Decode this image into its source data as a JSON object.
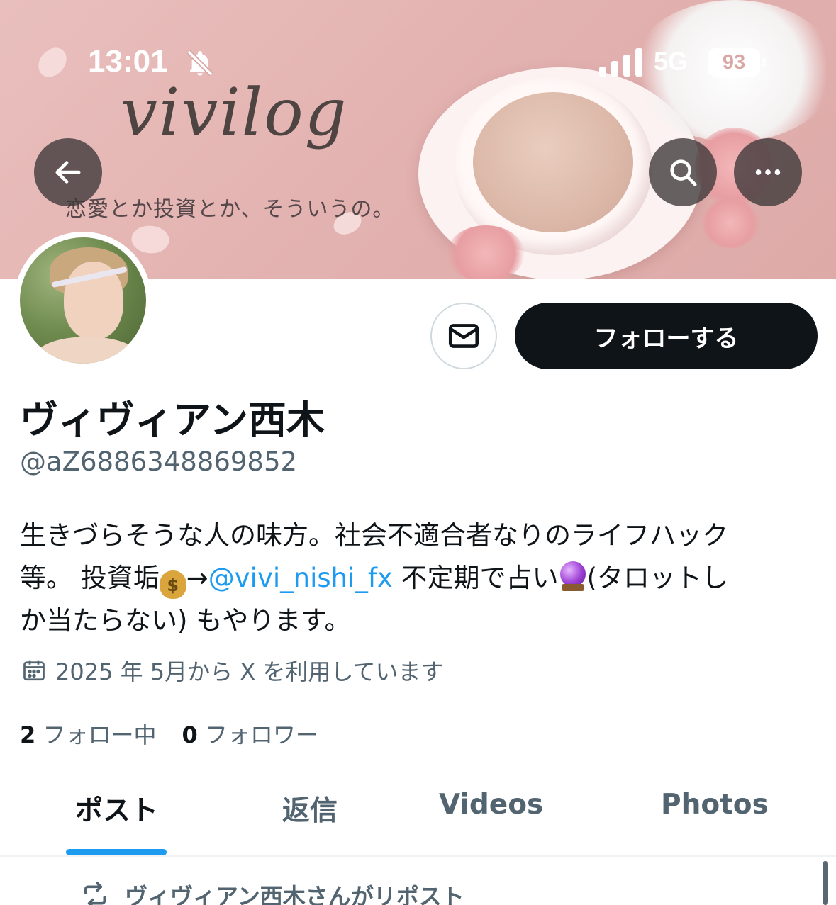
{
  "status_bar": {
    "time": "13:01",
    "network": "5G",
    "battery": "93",
    "icons": [
      "bell-slash-icon",
      "signal-bars-icon",
      "battery-icon"
    ]
  },
  "banner": {
    "logo_text": "vivilog",
    "tagline": "恋愛とか投資とか、そういうの。"
  },
  "header_buttons": {
    "back_icon": "arrow-left-icon",
    "search_icon": "search-icon",
    "more_icon": "more-horizontal-icon"
  },
  "actions": {
    "message_icon": "envelope-icon",
    "follow_label": "フォローする"
  },
  "profile": {
    "display_name": "ヴィヴィアン西木",
    "handle": "@aZ6886348869852",
    "bio": {
      "line1": "生きづらそうな人の味方。社会不適合者なりのライフハック",
      "line2_a": "等。 投資垢",
      "line2_b": "→",
      "link": "@vivi_nishi_fx",
      "line2_c": " 不定期で占い",
      "line2_d": "(タロットし",
      "line3": "か当たらない) もやります。",
      "emojis": [
        "money-bag-icon",
        "crystal-ball-icon"
      ]
    },
    "joined": "2025 年 5月から X を利用しています",
    "following_count": "2",
    "following_label": "フォロー中",
    "followers_count": "0",
    "followers_label": "フォロワー"
  },
  "tabs": [
    {
      "label": "ポスト",
      "active": true
    },
    {
      "label": "返信",
      "active": false
    },
    {
      "label": "Videos",
      "active": false
    },
    {
      "label": "Photos",
      "active": false
    }
  ],
  "feed": {
    "repost_label": "ヴィヴィアン西木さんがリポスト"
  },
  "colors": {
    "accent": "#1d9bf0",
    "text_primary": "#0f1419",
    "text_secondary": "#536471",
    "follow_button": "#0f1419",
    "banner_pink": "#e3b3b1"
  }
}
